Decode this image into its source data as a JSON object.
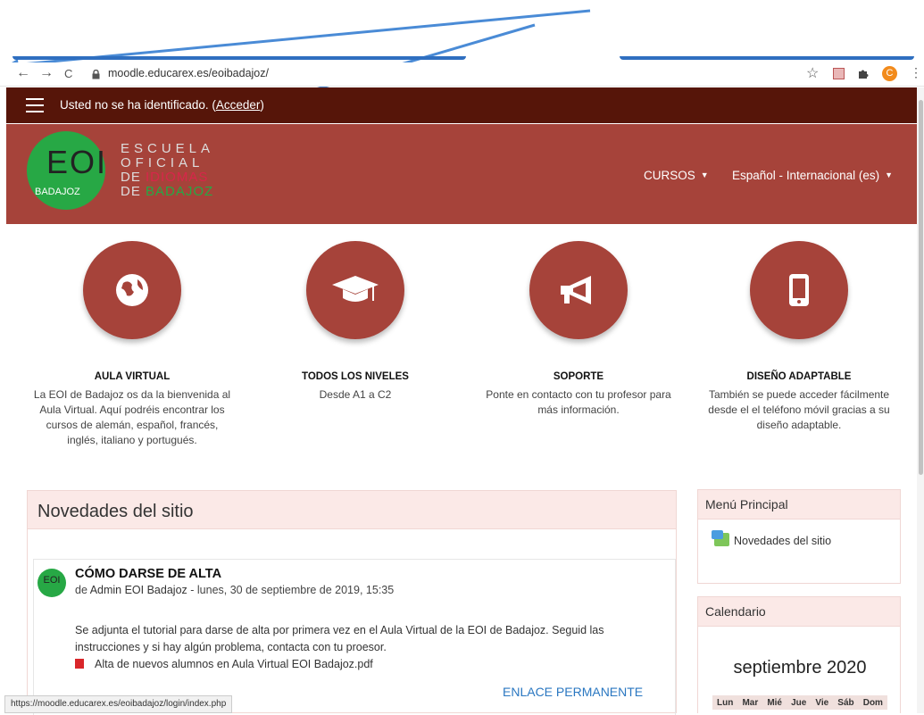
{
  "browser": {
    "url": "moodle.educarex.es/eoibadajoz/",
    "back_glyph": "←",
    "forward_glyph": "→",
    "reload_glyph": "C",
    "star_glyph": "☆",
    "profile_initial": "C"
  },
  "topnav": {
    "login_prefix": "Usted no se ha identificado. (",
    "login_link": "Acceder",
    "login_suffix": ")"
  },
  "header": {
    "logo_eoi": "EOI",
    "logo_badajoz": "BADAJOZ",
    "logo_line1": "ESCUELA",
    "logo_line2": "OFICIAL",
    "logo_line3_a": "DE ",
    "logo_line3_b": "IDIOMAS",
    "logo_line4_a": "DE ",
    "logo_line4_b": "BADAJOZ",
    "nav_cursos": "CURSOS",
    "nav_language": "Español - Internacional (es)"
  },
  "features": [
    {
      "title": "AULA VIRTUAL",
      "text": "La EOI de Badajoz os da la bienvenida al Aula Virtual. Aquí podréis encontrar los cursos de alemán, español, francés, inglés, italiano y portugués.",
      "icon": "globe-icon"
    },
    {
      "title": "TODOS LOS NIVELES",
      "text": "Desde A1 a C2",
      "icon": "graduation-cap-icon"
    },
    {
      "title": "SOPORTE",
      "text": "Ponte en contacto con tu profesor para más información.",
      "icon": "megaphone-icon"
    },
    {
      "title": "DISEÑO ADAPTABLE",
      "text": "También se puede acceder fácilmente desde el el teléfono móvil gracias a su diseño adaptable.",
      "icon": "mobile-icon"
    }
  ],
  "news": {
    "title": "Novedades del sitio",
    "post_title": "CÓMO DARSE DE ALTA",
    "post_meta_prefix": "de ",
    "post_author": "Admin EOI Badajoz",
    "post_date": " - lunes, 30 de septiembre de 2019, 15:35",
    "post_body": "Se adjunta el tutorial para darse de alta por primera vez en el Aula Virtual de la EOI de Badajoz. Seguid las instrucciones y si hay algún problema, contacta con tu proesor.",
    "attachment": "Alta de nuevos alumnos en Aula Virtual EOI Badajoz.pdf",
    "permalink": "ENLACE PERMANENTE",
    "avatar_text": "EOI"
  },
  "sidebar": {
    "menu_title": "Menú Principal",
    "menu_item": "Novedades del sitio",
    "calendar_title": "Calendario",
    "calendar_month": "septiembre 2020",
    "weekdays": [
      "Lun",
      "Mar",
      "Mié",
      "Jue",
      "Vie",
      "Sáb",
      "Dom"
    ]
  },
  "status_url": "https://moodle.educarex.es/eoibadajoz/login/index.php",
  "colors": {
    "topnav": "#561509",
    "header": "#a6433a",
    "logo_green": "#27a845",
    "annotation_arrow": "#4a8bd6",
    "link_blue": "#2a77c1"
  }
}
